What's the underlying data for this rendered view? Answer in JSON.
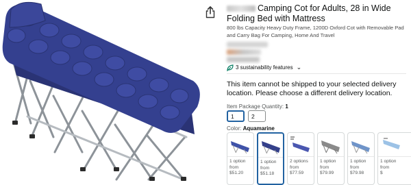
{
  "product": {
    "title_rest": "Camping Cot for Adults, 28 in Wide Folding Bed with Mattress",
    "subtitle": "800 lbs Capacity Heavy Duty Frame, 1200D Oxford Cot with Removable Pad and Carry Bag For Camping, Home And Travel"
  },
  "sustainability": {
    "label": "3 sustainability features"
  },
  "delivery_notice": "This item cannot be shipped to your selected delivery location. Please choose a different delivery location.",
  "quantity": {
    "label": "Item Package Quantity:",
    "selected": "1",
    "options": [
      "1",
      "2"
    ]
  },
  "color": {
    "label": "Color:",
    "selected": "Aquamarine",
    "swatches": [
      {
        "option_text": "1 option\nfrom",
        "price": "$51.20",
        "selected": false,
        "tint": "#3f52a8"
      },
      {
        "option_text": "1 option\nfrom",
        "price": "$51.18",
        "selected": true,
        "tint": "#34408a"
      },
      {
        "option_text": "2 options\nfrom",
        "price": "$77.59",
        "selected": false,
        "tint": "#4a57b0"
      },
      {
        "option_text": "1 option\nfrom",
        "price": "$79.99",
        "selected": false,
        "tint": "#8a8a8a"
      },
      {
        "option_text": "1 option\nfrom",
        "price": "$79.98",
        "selected": false,
        "tint": "#6f94c9"
      },
      {
        "option_text": "1 option\nfrom",
        "price": "$",
        "selected": false,
        "tint": "#9cc2e6"
      }
    ]
  },
  "colors": {
    "accent": "#2162a1",
    "cot_blue": "#34408f",
    "frame": "#9aa0a6",
    "text": "#0f1111",
    "muted": "#565959"
  }
}
